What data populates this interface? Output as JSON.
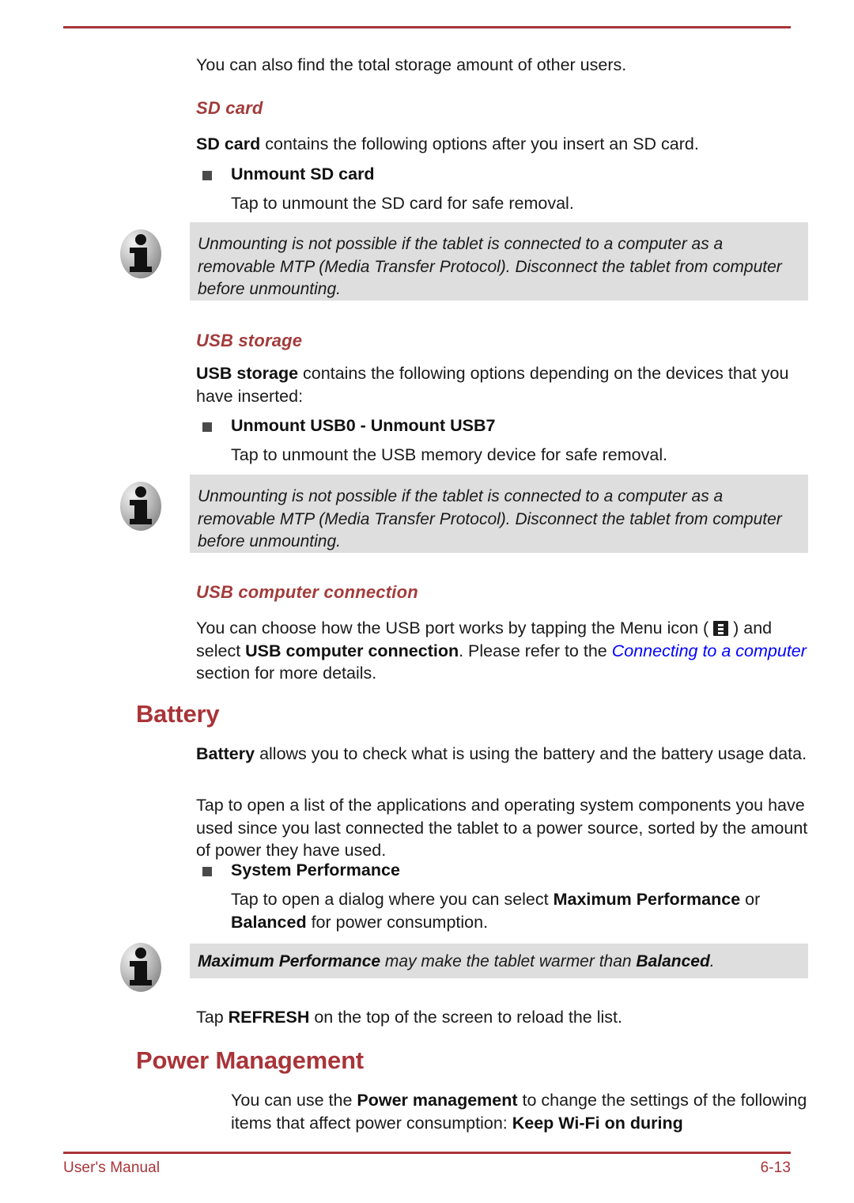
{
  "page": {
    "footer_left": "User's Manual",
    "footer_right": "6-13",
    "accent_color": "#a93439",
    "subhead_color": "#a33b3b",
    "note_bg": "#dedede",
    "link_color": "#0000ff"
  },
  "intro": {
    "text": "You can also find the total storage amount of other users."
  },
  "sd_card": {
    "heading": "SD card",
    "intro_bold": "SD card",
    "intro_rest": " contains the following options after you insert an SD card.",
    "bullet_label": "Unmount SD card",
    "bullet_body": "Tap to unmount the SD card for safe removal."
  },
  "note_sd": {
    "icon": "info-icon",
    "text": "Unmounting is not possible if the tablet is connected to a computer as a removable MTP (Media Transfer Protocol). Disconnect the tablet from computer before unmounting."
  },
  "usb_storage": {
    "heading": "USB storage",
    "intro_bold": "USB storage",
    "intro_rest": " contains the following options depending on the devices that you have inserted:",
    "bullet_label": "Unmount USB0 - Unmount USB7",
    "bullet_body": "Tap to unmount the USB memory device for safe removal."
  },
  "note_usb": {
    "icon": "info-icon",
    "text": "Unmounting is not possible if the tablet is connected to a computer as a removable MTP (Media Transfer Protocol). Disconnect the tablet from computer before unmounting."
  },
  "usb_computer_connection": {
    "heading": "USB computer connection",
    "part1": "You can choose how the USB port works by tapping the Menu icon ( ",
    "icon": "menu-icon",
    "part2": " ) and select ",
    "bold1": "USB computer connection",
    "part3": ". Please refer to the ",
    "link": "Connecting to a computer",
    "part4": " section for more details."
  },
  "battery": {
    "heading": "Battery",
    "p1_bold": "Battery",
    "p1_rest": " allows you to check what is using the battery and the battery usage data.",
    "p2": "Tap to open a list of the applications and operating system components you have used since you last connected the tablet to a power source, sorted by the amount of power they have used.",
    "bullet_label": "System Performance",
    "bullet_body_part1": "Tap to open a dialog where you can select ",
    "bullet_body_bold1": "Maximum Performance",
    "bullet_body_part2": " or ",
    "bullet_body_bold2": "Balanced",
    "bullet_body_part3": " for power consumption.",
    "refresh_part1": "Tap ",
    "refresh_bold": "REFRESH",
    "refresh_part2": " on the top of the screen to reload the list."
  },
  "note_battery": {
    "icon": "info-icon",
    "bold1": "Maximum Performance",
    "mid": " may make the tablet warmer than ",
    "bold2": "Balanced",
    "tail": "."
  },
  "power_management": {
    "heading": "Power Management",
    "part1": "You can use the ",
    "bold1": "Power management",
    "part2": " to change the settings of the following items that affect power consumption: ",
    "bold2": "Keep Wi-Fi on during"
  }
}
